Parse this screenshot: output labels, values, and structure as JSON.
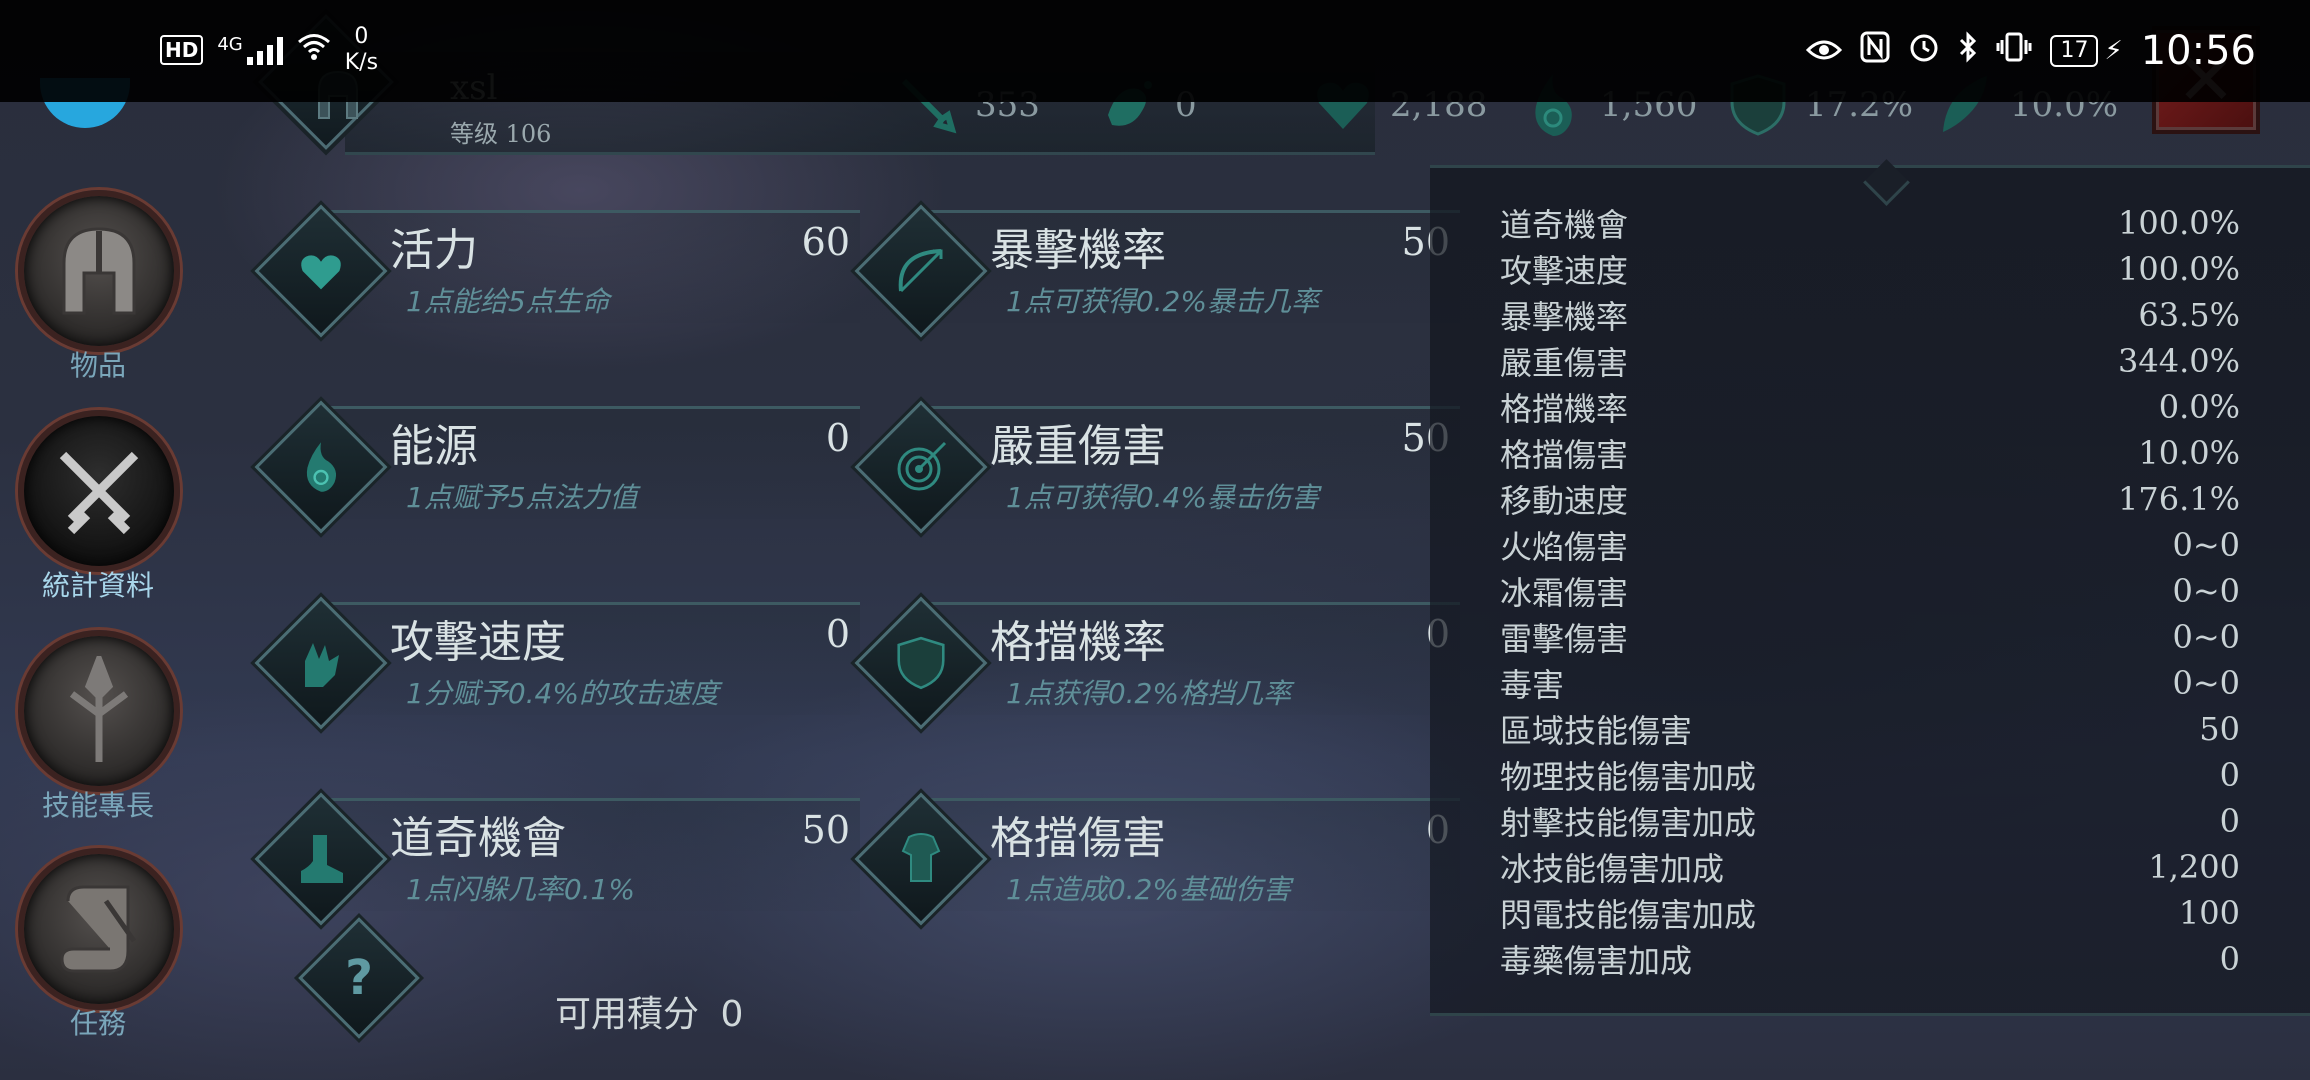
{
  "status_bar": {
    "hd": "HD",
    "network": "4G",
    "net_speed_value": "0",
    "net_speed_unit": "K/s",
    "battery": "17",
    "time": "10:56"
  },
  "player": {
    "name": "xsl",
    "level": "等级 106"
  },
  "top_stats": [
    {
      "icon": "sword-icon",
      "value": "353"
    },
    {
      "icon": "splash-icon",
      "value": "0"
    },
    {
      "icon": "heart-icon",
      "value": "2,188"
    },
    {
      "icon": "mana-flame-icon",
      "value": "1,560"
    },
    {
      "icon": "shield-icon",
      "value": "17.2%"
    },
    {
      "icon": "feather-icon",
      "value": "10.0%"
    }
  ],
  "nav": [
    {
      "label": "物品",
      "icon": "helmet-icon"
    },
    {
      "label": "統計資料",
      "icon": "crossed-swords-icon"
    },
    {
      "label": "技能專長",
      "icon": "skill-tree-icon"
    },
    {
      "label": "任務",
      "icon": "scroll-icon"
    }
  ],
  "attributes": [
    {
      "title": "活力",
      "value": "60",
      "desc": "1点能给5点生命",
      "icon": "heart-icon"
    },
    {
      "title": "暴擊機率",
      "value": "50",
      "desc": "1点可获得0.2%暴击几率",
      "icon": "bow-icon"
    },
    {
      "title": "能源",
      "value": "0",
      "desc": "1点赋予5点法力值",
      "icon": "energy-flame-icon"
    },
    {
      "title": "嚴重傷害",
      "value": "50",
      "desc": "1点可获得0.4%暴击伤害",
      "icon": "target-icon"
    },
    {
      "title": "攻擊速度",
      "value": "0",
      "desc": "1分赋予0.4%的攻击速度",
      "icon": "gauntlet-icon"
    },
    {
      "title": "格擋機率",
      "value": "0",
      "desc": "1点获得0.2%格挡几率",
      "icon": "shield-icon"
    },
    {
      "title": "道奇機會",
      "value": "50",
      "desc": "1点闪躲几率0.1%",
      "icon": "boot-icon"
    },
    {
      "title": "格擋傷害",
      "value": "0",
      "desc": "1点造成0.2%基础伤害",
      "icon": "armor-icon"
    }
  ],
  "available_points": {
    "label": "可用積分",
    "value": "0"
  },
  "stats": [
    {
      "k": "道奇機會",
      "v": "100.0%"
    },
    {
      "k": "攻擊速度",
      "v": "100.0%"
    },
    {
      "k": "暴擊機率",
      "v": "63.5%"
    },
    {
      "k": "嚴重傷害",
      "v": "344.0%"
    },
    {
      "k": "格擋機率",
      "v": "0.0%"
    },
    {
      "k": "格擋傷害",
      "v": "10.0%"
    },
    {
      "k": "移動速度",
      "v": "176.1%"
    },
    {
      "k": "火焰傷害",
      "v": "0~0"
    },
    {
      "k": "冰霜傷害",
      "v": "0~0"
    },
    {
      "k": "雷擊傷害",
      "v": "0~0"
    },
    {
      "k": "毒害",
      "v": "0~0"
    },
    {
      "k": "區域技能傷害",
      "v": "50"
    },
    {
      "k": "物理技能傷害加成",
      "v": "0"
    },
    {
      "k": "射擊技能傷害加成",
      "v": "0"
    },
    {
      "k": "冰技能傷害加成",
      "v": "1,200"
    },
    {
      "k": "閃電技能傷害加成",
      "v": "100"
    },
    {
      "k": "毒藥傷害加成",
      "v": "0"
    }
  ],
  "colors": {
    "accent": "#3fa59c",
    "nav_label": "#7aa6ba",
    "close": "#7a1e1e"
  }
}
